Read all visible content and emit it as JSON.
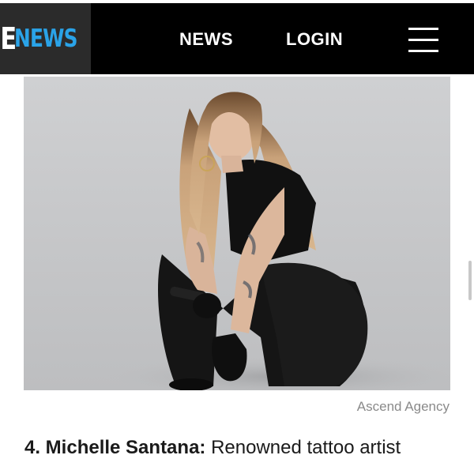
{
  "header": {
    "logo": {
      "letter": "E",
      "word": "NEWS"
    },
    "nav": {
      "news_label": "NEWS",
      "login_label": "LOGIN"
    },
    "menu_icon": "hamburger-menu-icon"
  },
  "article": {
    "photo_credit": "Ascend Agency",
    "caption_number_name": "4. Michelle Santana:",
    "caption_text": " Renowned tattoo artist"
  },
  "colors": {
    "header_bg": "#000000",
    "logo_bg": "#2b2b2b",
    "logo_accent": "#2aa3e8",
    "credit_text": "#8a8a8a"
  }
}
